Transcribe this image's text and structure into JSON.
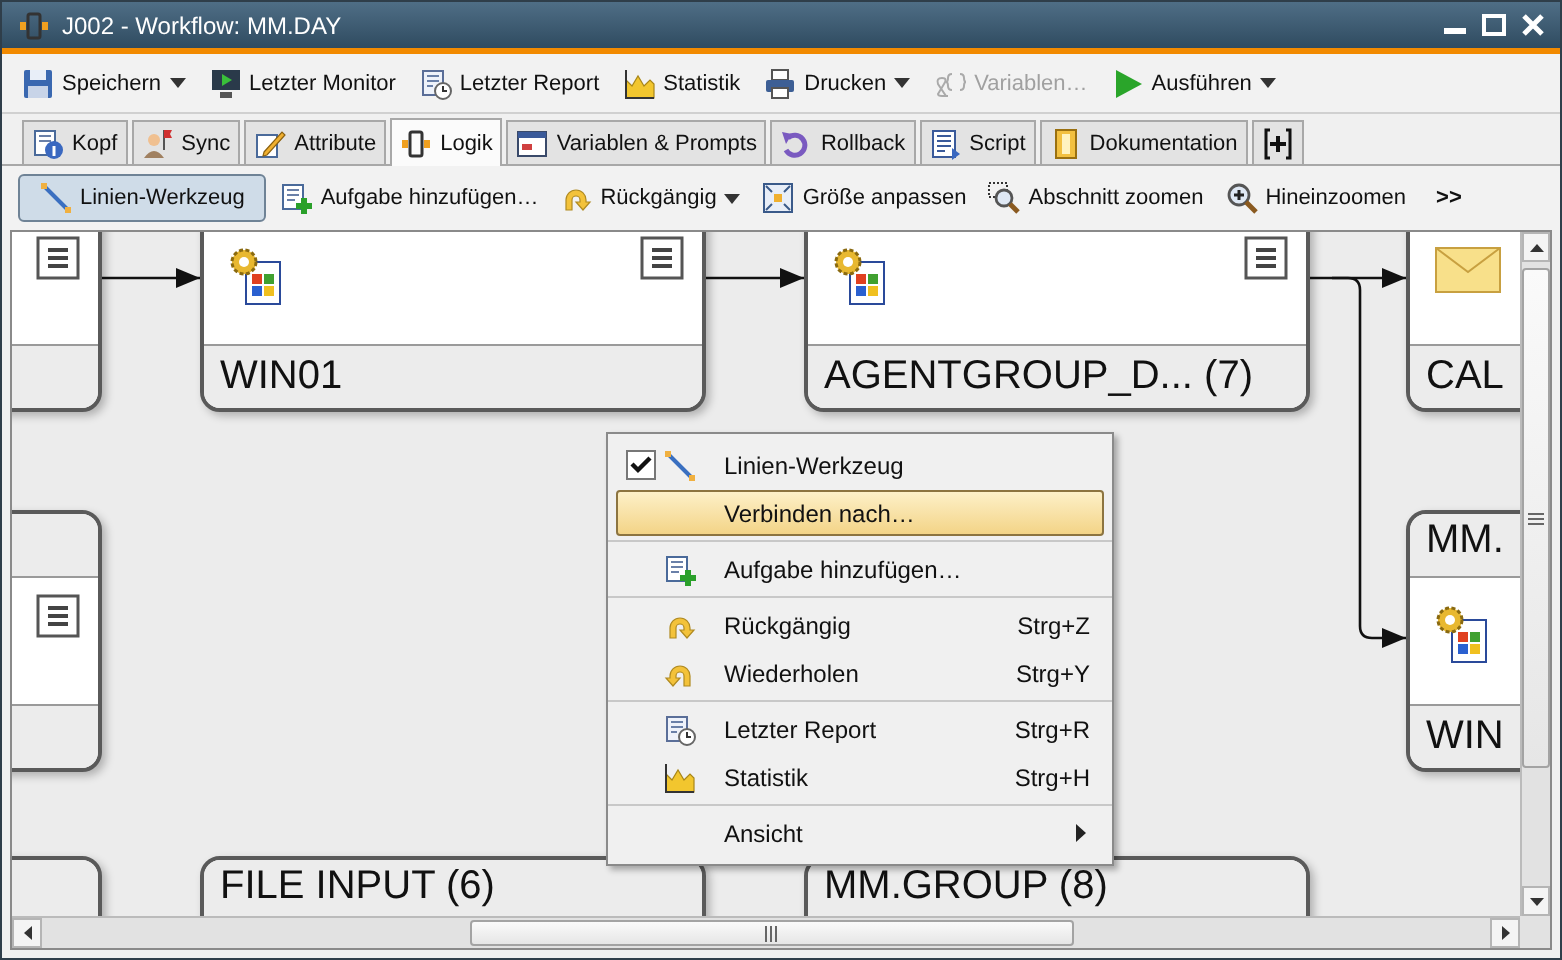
{
  "window": {
    "title": "J002 - Workflow: MM.DAY"
  },
  "toolbar": [
    {
      "label": "Speichern",
      "dropdown": true,
      "disabled": false
    },
    {
      "label": "Letzter Monitor",
      "dropdown": false,
      "disabled": false
    },
    {
      "label": "Letzter Report",
      "dropdown": false,
      "disabled": false
    },
    {
      "label": "Statistik",
      "dropdown": false,
      "disabled": false
    },
    {
      "label": "Drucken",
      "dropdown": true,
      "disabled": false
    },
    {
      "label": "Variablen…",
      "dropdown": false,
      "disabled": true
    },
    {
      "label": "Ausführen",
      "dropdown": true,
      "disabled": false
    }
  ],
  "tabs": [
    {
      "kind": "page",
      "label": "Kopf",
      "selected": false
    },
    {
      "kind": "page",
      "label": "Sync",
      "selected": false
    },
    {
      "kind": "page",
      "label": "Attribute",
      "selected": false
    },
    {
      "kind": "page",
      "label": "Logik",
      "selected": true
    },
    {
      "kind": "page",
      "label": "Variablen & Prompts",
      "selected": false
    },
    {
      "kind": "page",
      "label": "Rollback",
      "selected": false
    },
    {
      "kind": "page",
      "label": "Script",
      "selected": false
    },
    {
      "kind": "page",
      "label": "Dokumentation",
      "selected": false
    },
    {
      "kind": "add",
      "selected": false
    }
  ],
  "tools": {
    "items": [
      {
        "label": "Linien-Werkzeug",
        "dropdown": false,
        "selected": true
      },
      {
        "label": "Aufgabe hinzufügen…",
        "dropdown": false,
        "selected": false
      },
      {
        "label": "Rückgängig",
        "dropdown": true,
        "selected": false
      },
      {
        "label": "Größe anpassen",
        "dropdown": false,
        "selected": false
      },
      {
        "label": "Abschnitt zoomen",
        "dropdown": false,
        "selected": false
      },
      {
        "label": "Hineinzoomen",
        "dropdown": false,
        "selected": false
      }
    ],
    "overflow": ">>"
  },
  "canvas": {
    "nodes": [
      {
        "kind": "blank"
      },
      {
        "kind": "windows",
        "title": "WIN01"
      },
      {
        "kind": "windows",
        "title": "AGENTGROUP_D... (7)"
      },
      {
        "kind": "email",
        "title": "CAL"
      },
      {
        "kind": "blank"
      },
      {
        "kind": "windows",
        "header": "MM.",
        "title": "WIN"
      },
      {
        "kind": "blank"
      },
      {
        "kind": "blank",
        "header": "FILE INPUT (6)"
      },
      {
        "kind": "blank",
        "header": "MM.GROUP (8)"
      }
    ],
    "context_menu": {
      "groups": [
        [
          {
            "kind": "check",
            "label": "Linien-Werkzeug",
            "checked": true,
            "selected": false
          },
          {
            "kind": "action",
            "label": "Verbinden nach…",
            "selected": true
          }
        ],
        [
          {
            "kind": "action",
            "label": "Aufgabe hinzufügen…",
            "selected": false
          }
        ],
        [
          {
            "kind": "action",
            "label": "Rückgängig",
            "shortcut": "Strg+Z",
            "selected": false
          },
          {
            "kind": "action",
            "label": "Wiederholen",
            "shortcut": "Strg+Y",
            "selected": false
          }
        ],
        [
          {
            "kind": "action",
            "label": "Letzter Report",
            "shortcut": "Strg+R",
            "selected": false
          },
          {
            "kind": "action",
            "label": "Statistik",
            "shortcut": "Strg+H",
            "selected": false
          }
        ],
        [
          {
            "kind": "submenu",
            "label": "Ansicht",
            "selected": false
          }
        ]
      ]
    }
  }
}
